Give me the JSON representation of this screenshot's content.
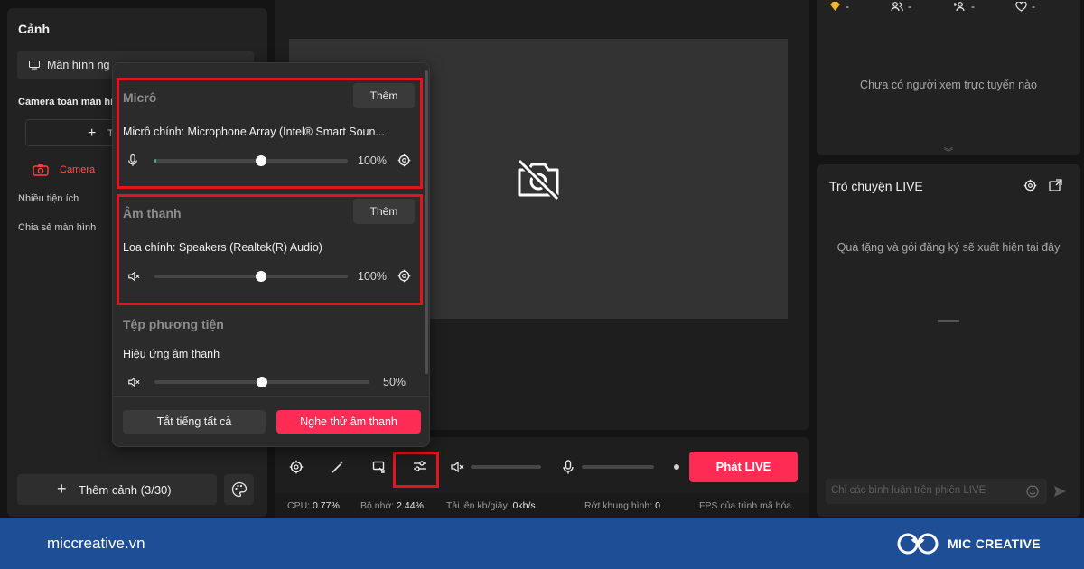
{
  "scene_panel": {
    "title": "Cảnh",
    "scene_select": "Màn hình ng",
    "source_label": "Camera toàn màn hì",
    "add_source_label": "T",
    "camera_label": "Camera",
    "utilities_label": "Nhiều tiện ích",
    "share_screen_label": "Chia sẻ màn hình",
    "add_scene_button": "Thêm cảnh (3/30)"
  },
  "audio_popup": {
    "mic_section_title": "Micrô",
    "mic_add_button": "Thêm",
    "mic_device": "Micrô chính: Microphone Array (Intel® Smart Soun...",
    "mic_level": 0.55,
    "mic_percent": "100%",
    "sound_section_title": "Âm thanh",
    "sound_add_button": "Thêm",
    "speaker_device": "Loa chính: Speakers (Realtek(R) Audio)",
    "speaker_level": 0.55,
    "speaker_percent": "100%",
    "media_section_title": "Tệp phương tiện",
    "effects_label": "Hiệu ứng âm thanh",
    "effects_level": 0.5,
    "effects_percent": "50%",
    "mute_all_button": "Tắt tiếng tất cả",
    "test_sound_button": "Nghe thử âm thanh"
  },
  "controls": {
    "go_live_button": "Phát LIVE",
    "speaker_volume": 0.0,
    "mic_volume": 0.0
  },
  "status": {
    "cpu_label": "CPU:",
    "cpu_value": "0.77%",
    "memory_label": "Bộ nhớ:",
    "memory_value": "2.44%",
    "upload_label": "Tải lên kb/giây:",
    "upload_value": "0kb/s",
    "dropped_label": "Rớt khung hình:",
    "dropped_value": "0",
    "fps_label": "FPS của trình mã hóa"
  },
  "stats": {
    "gems": "-",
    "viewers": "-",
    "followers": "-",
    "likes": "-",
    "no_viewers_message": "Chưa có người xem trực tuyến nào"
  },
  "chat": {
    "title": "Trò chuyện LIVE",
    "gifts_message": "Quà tặng và gói đăng ký sẽ xuất hiện tại đây",
    "comment_placeholder": "Chỉ các bình luận trên phiên LIVE"
  },
  "footer": {
    "website": "miccreative.vn",
    "brand": "MIC CREATIVE"
  },
  "colors": {
    "accent_pink": "#fe2c55",
    "highlight_red": "#e0161e",
    "footer_blue": "#1e4e96",
    "level_green": "#33c06b"
  }
}
